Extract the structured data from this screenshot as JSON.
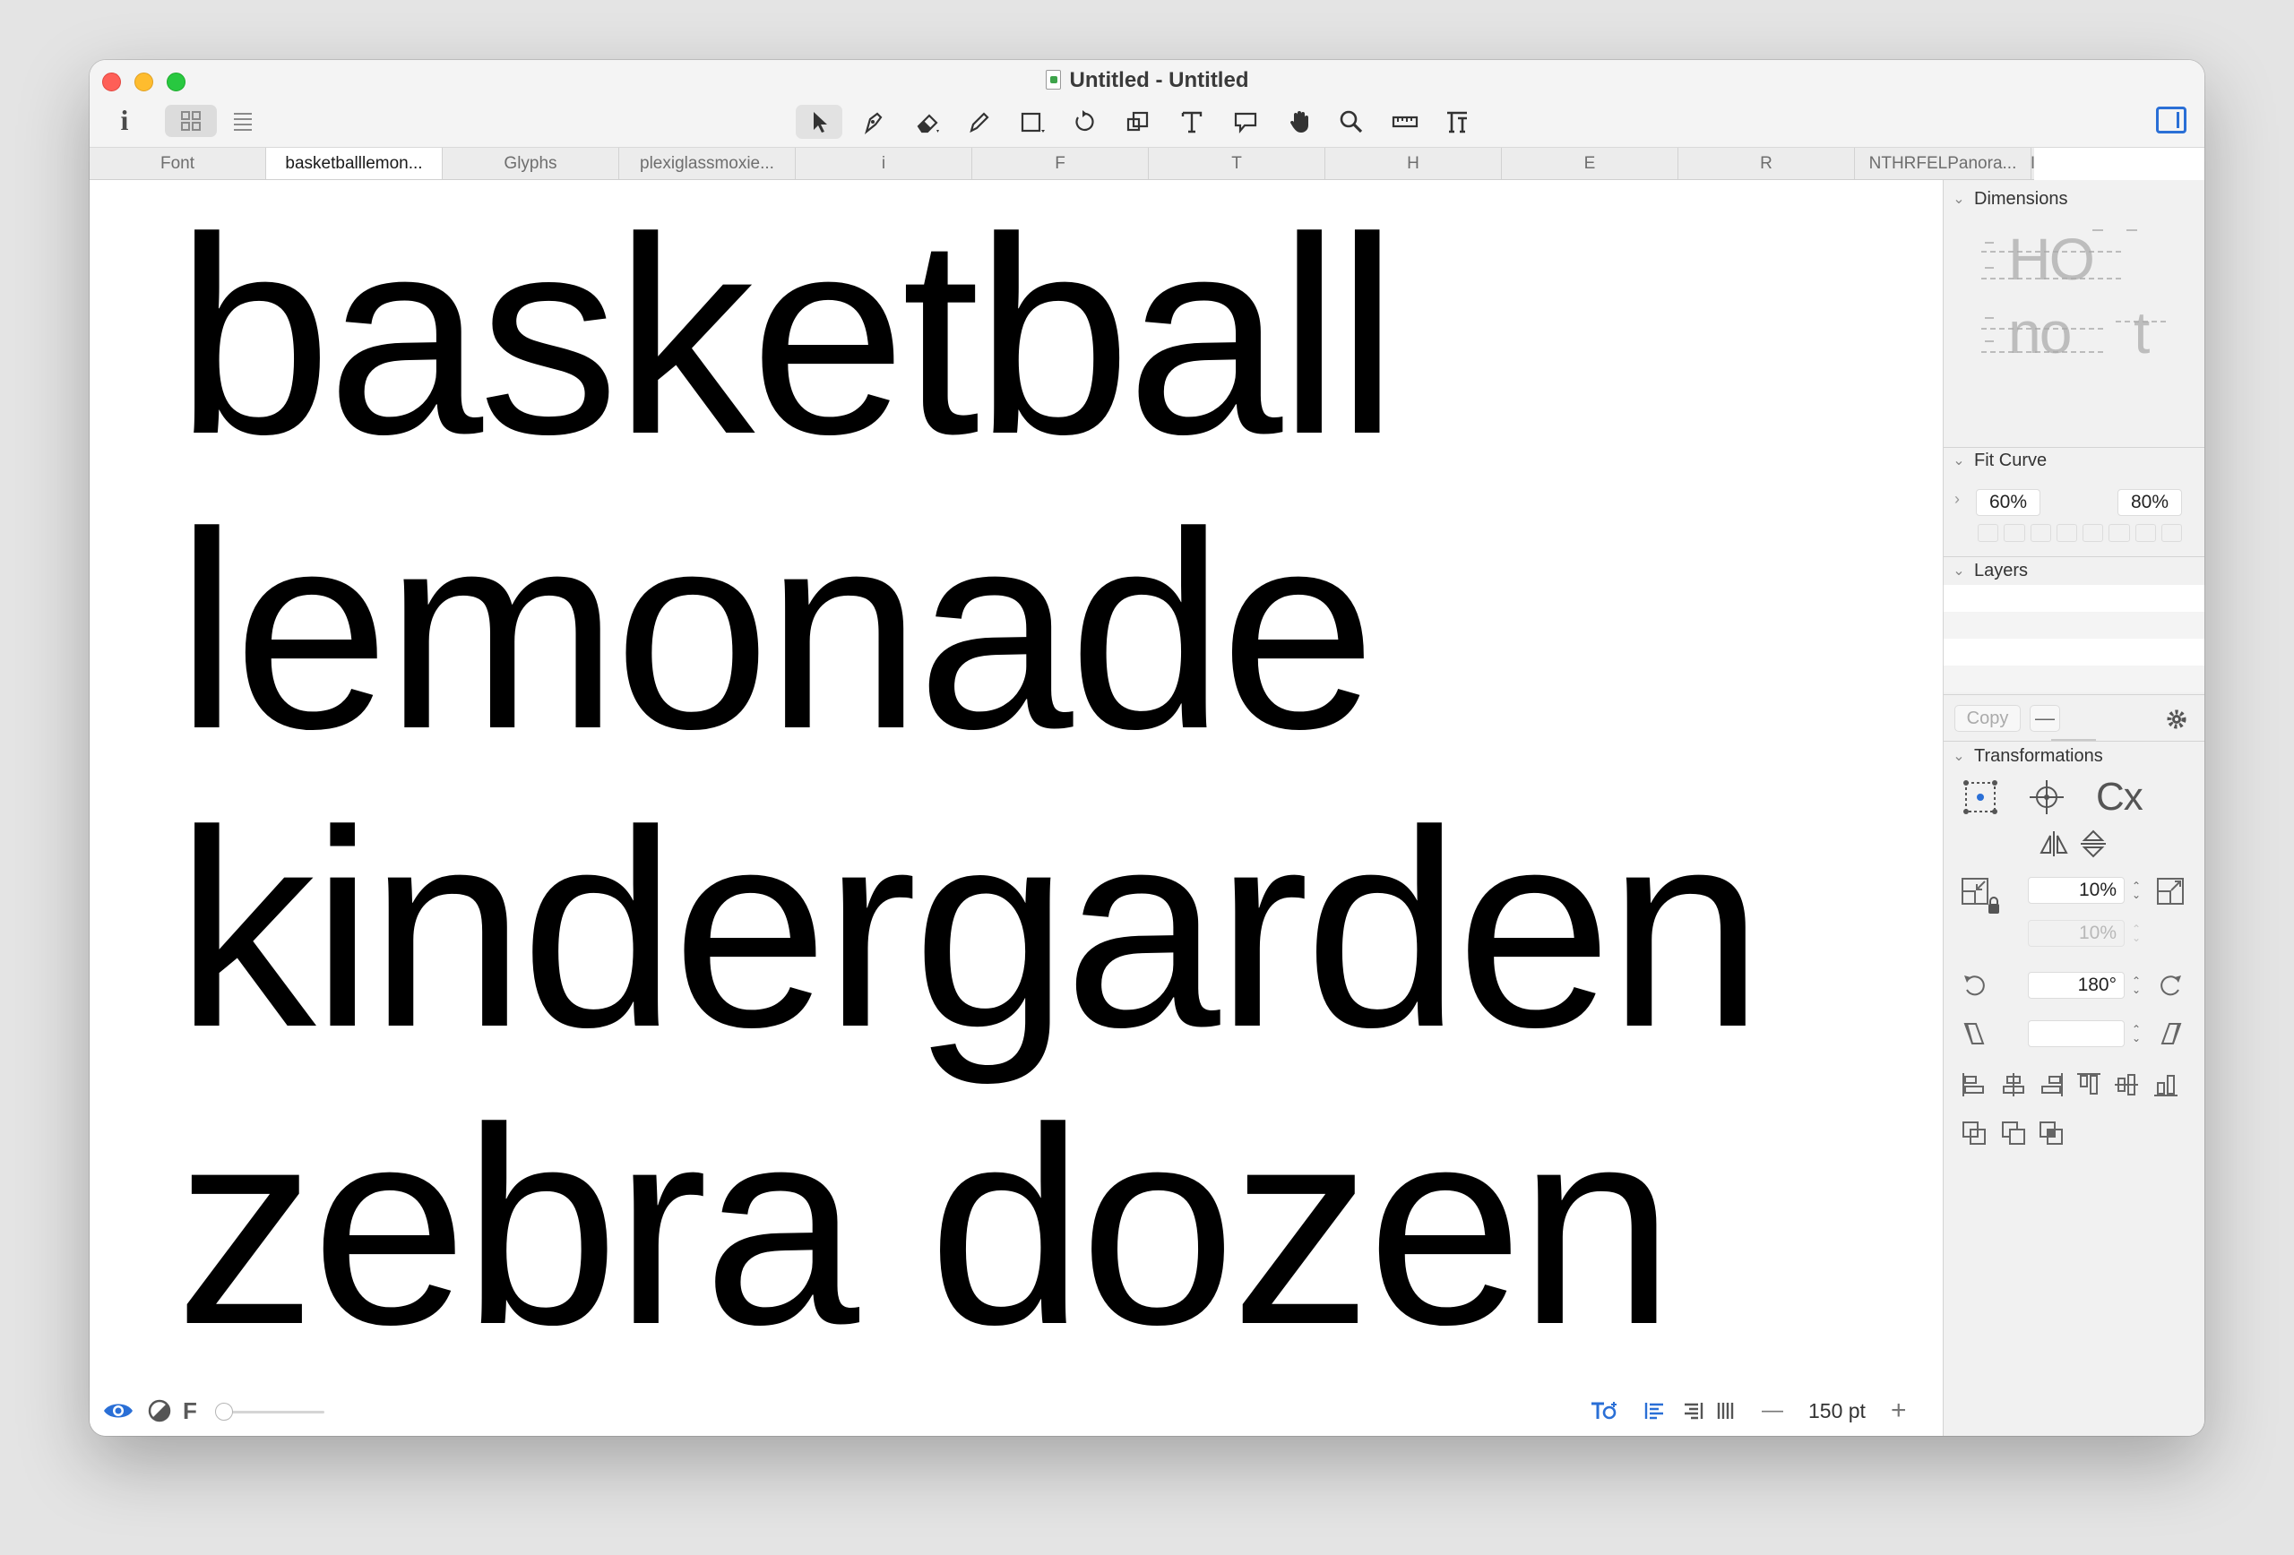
{
  "window": {
    "title": "Untitled - Untitled"
  },
  "toolbar": {
    "info_label": "i",
    "tools": [
      "select-arrow-icon",
      "pen-icon",
      "eraser-icon",
      "pencil-icon",
      "rectangle-icon",
      "rotate-icon",
      "scale-icon",
      "text-icon",
      "annotation-icon",
      "hand-icon",
      "zoom-icon",
      "measure-icon",
      "type-tool-icon"
    ]
  },
  "tabs": [
    "Font",
    "basketballlemon...",
    "Glyphs",
    "plexiglassmoxie...",
    "i",
    "F",
    "T",
    "H",
    "E",
    "R",
    "NTHRFELPanora...",
    "I"
  ],
  "canvas": {
    "lines": [
      "basketball",
      "lemonade",
      "kindergarden",
      "zebra dozen"
    ]
  },
  "bottombar": {
    "font_label": "F",
    "font_size": "150 pt",
    "minus": "—",
    "plus": "+"
  },
  "panel": {
    "dimensions": {
      "header": "Dimensions",
      "sample_top": "HO",
      "sample_bottom_left": "no",
      "sample_bottom_right": "t"
    },
    "fit_curve": {
      "header": "Fit Curve",
      "min": "60%",
      "max": "80%"
    },
    "layers": {
      "header": "Layers",
      "copy_label": "Copy",
      "remove_label": "—"
    },
    "transformations": {
      "header": "Transformations",
      "cx_label": "Cx",
      "scale_value": "10%",
      "scale_value_dim": "10%",
      "rotate_value": "180°",
      "slant_value": ""
    }
  },
  "colors": {
    "accent": "#2a6fd6",
    "close": "#fe5f57",
    "minimize": "#febc2e",
    "maximize": "#28c840"
  }
}
